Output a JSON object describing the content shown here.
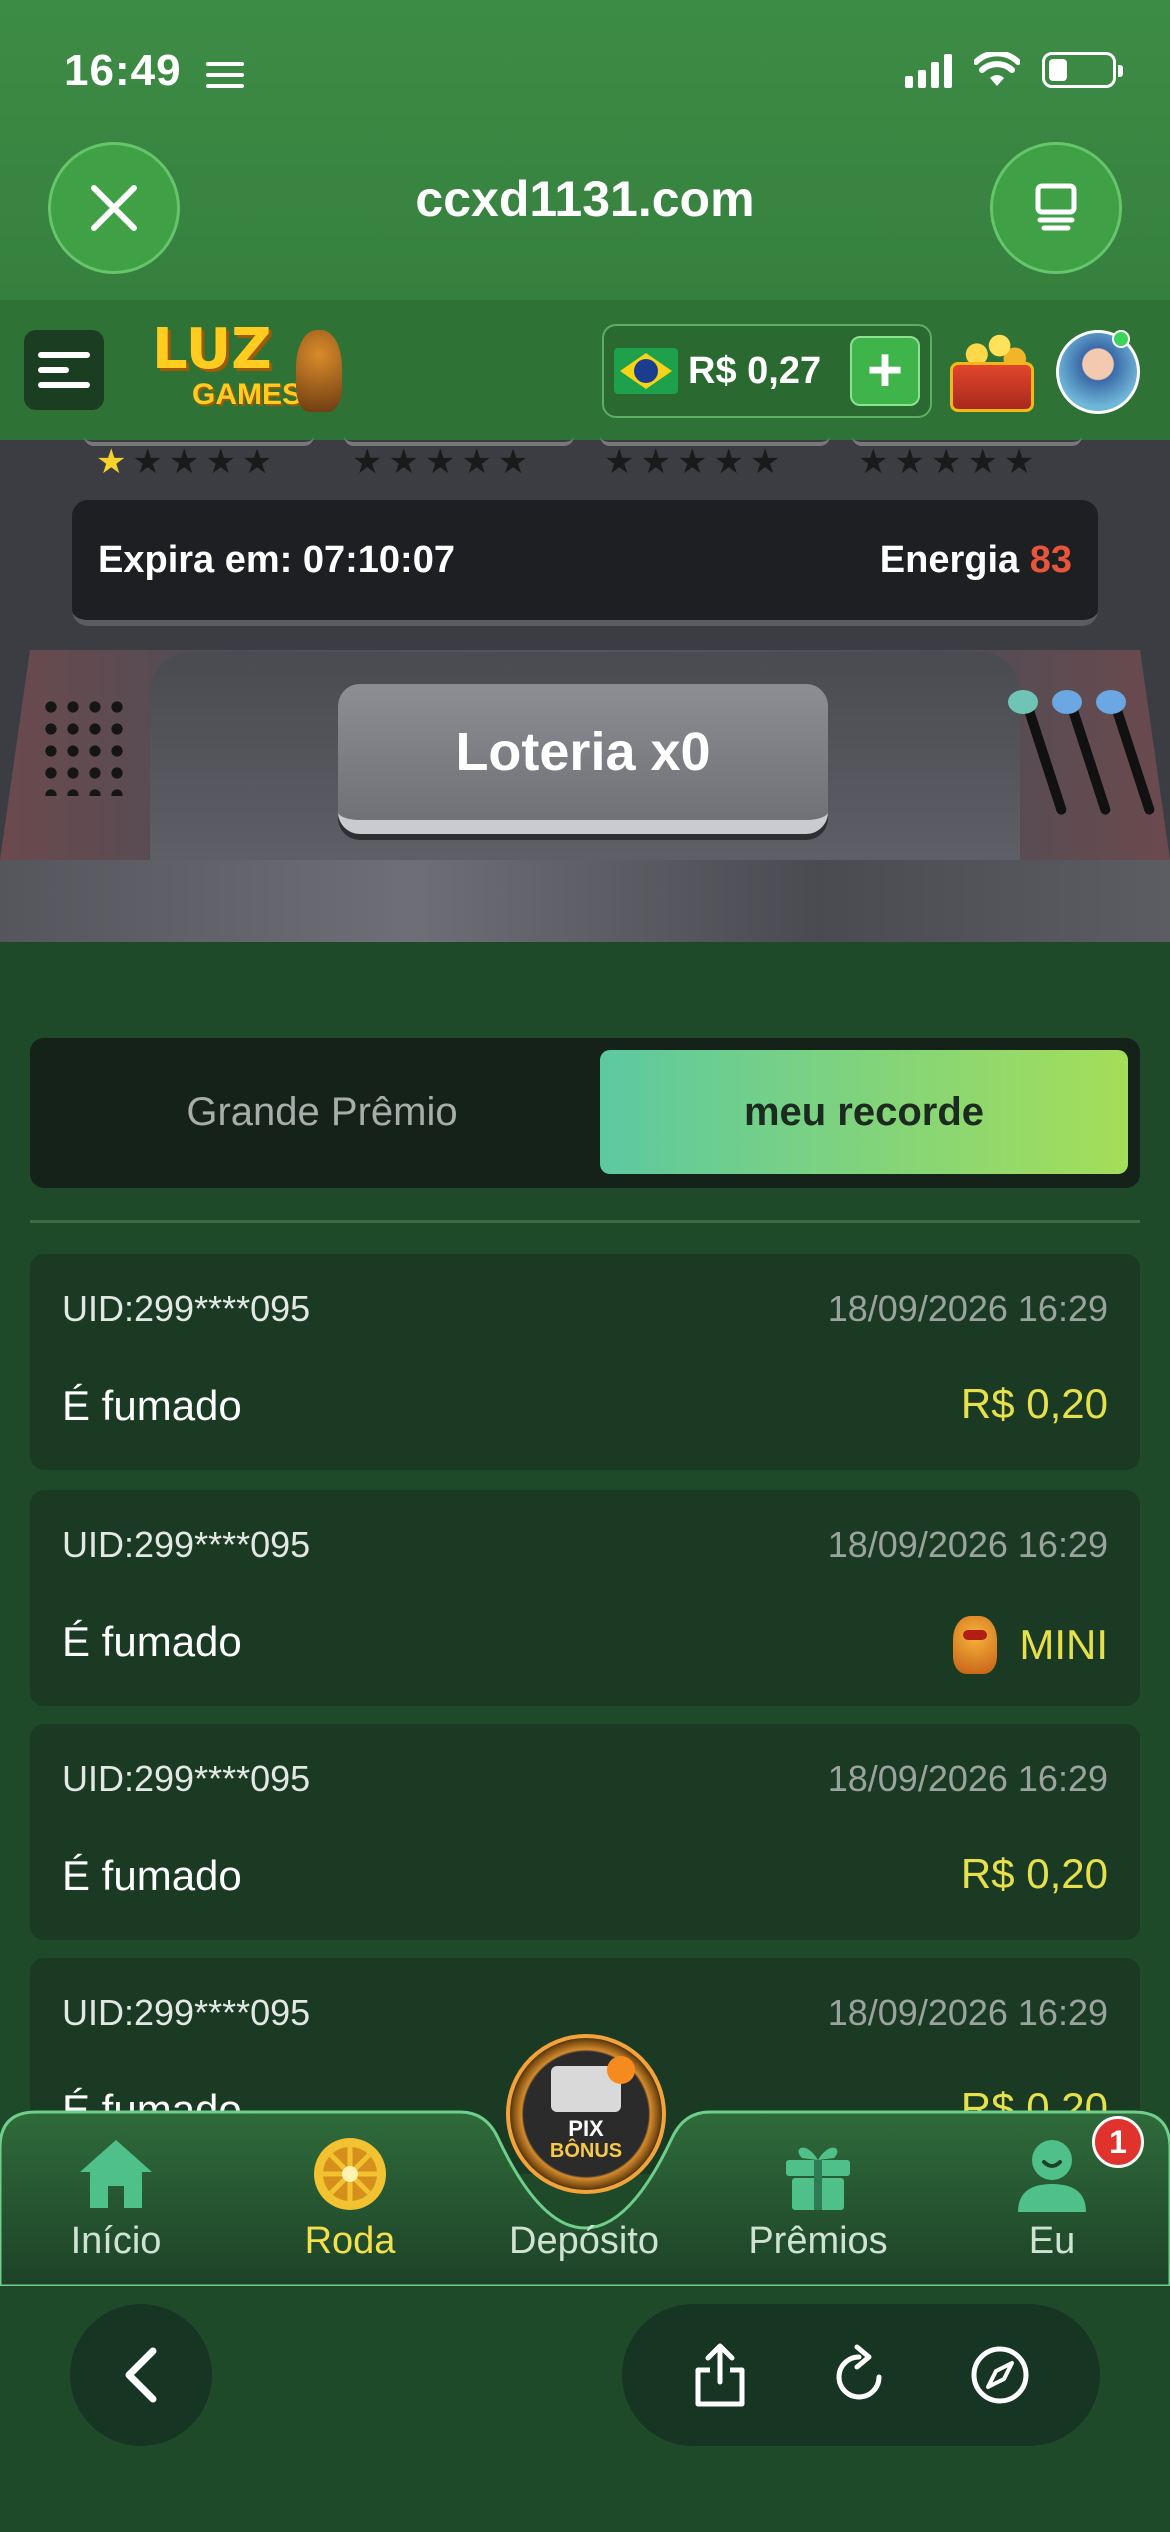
{
  "status": {
    "time": "16:49"
  },
  "browser": {
    "url": "ccxd1131.com"
  },
  "header": {
    "logo_line1": "LUZ",
    "logo_line2": "GAMES",
    "balance": "R$ 0,27",
    "add_label": "+"
  },
  "machine": {
    "expire_label": "Expira em: 07:10:07",
    "energy_label": "Energia",
    "energy_value": "83",
    "lottery_button": "Loteria x0",
    "star_groups": [
      {
        "filled": 1,
        "total": 5
      },
      {
        "filled": 0,
        "total": 5
      },
      {
        "filled": 0,
        "total": 5
      },
      {
        "filled": 0,
        "total": 5
      }
    ]
  },
  "tabs": {
    "left": "Grande Prêmio",
    "right": "meu recorde",
    "active": "right"
  },
  "records": [
    {
      "uid": "UID:299****095",
      "time": "18/09/2026 16:29",
      "name": "É fumado",
      "prize": "R$ 0,20",
      "icon": ""
    },
    {
      "uid": "UID:299****095",
      "time": "18/09/2026 16:29",
      "name": "É fumado",
      "prize": "MINI",
      "icon": "mini-jackpot-icon"
    },
    {
      "uid": "UID:299****095",
      "time": "18/09/2026 16:29",
      "name": "É fumado",
      "prize": "R$ 0,20",
      "icon": ""
    },
    {
      "uid": "UID:299****095",
      "time": "18/09/2026 16:29",
      "name": "É fumado",
      "prize": "R$ 0,20",
      "icon": ""
    }
  ],
  "nav": {
    "items": [
      {
        "label": "Início",
        "icon": "home-icon"
      },
      {
        "label": "Roda",
        "icon": "wheel-icon"
      },
      {
        "label": "Depósito",
        "icon": "pix-bonus-icon"
      },
      {
        "label": "Prêmios",
        "icon": "gift-icon"
      },
      {
        "label": "Eu",
        "icon": "user-icon"
      }
    ],
    "active": "Roda",
    "pix_text1": "PIX",
    "pix_text2": "BÔNUS",
    "badge": "1"
  },
  "colors": {
    "accent_green": "#3d8c45",
    "active_yellow": "#f3e04a",
    "prize_yellow": "#e6e04b",
    "energy_red": "#e8553b"
  }
}
